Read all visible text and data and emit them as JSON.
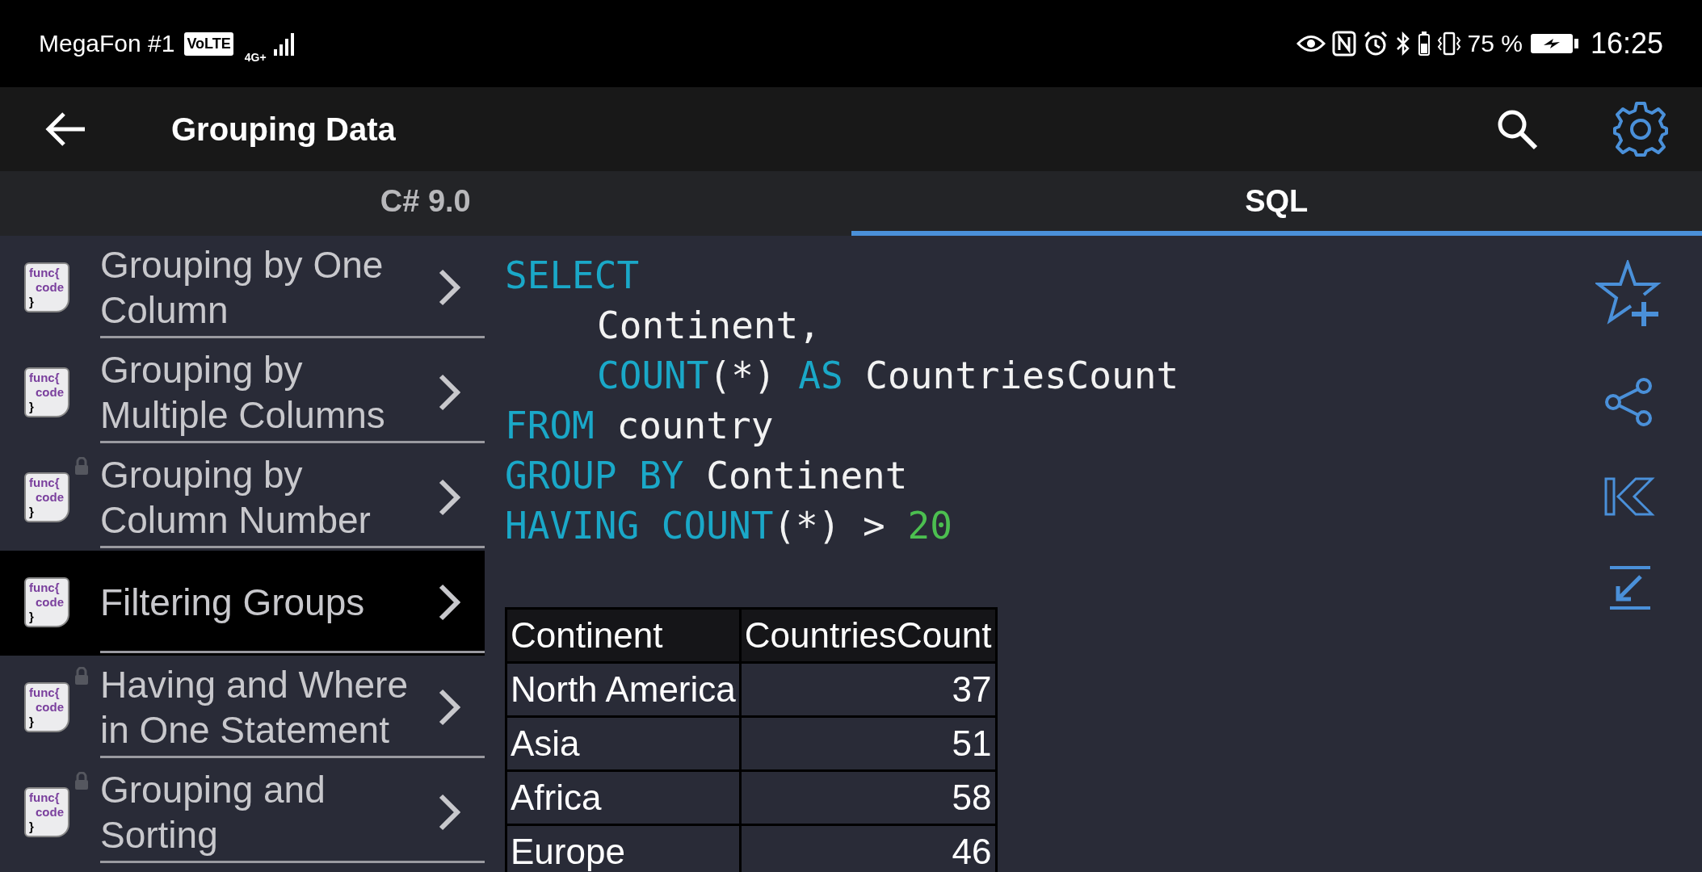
{
  "status_bar": {
    "carrier": "MegaFon #1",
    "volte": "VoLTE",
    "network": "4G+",
    "battery": "75 %",
    "time": "16:25"
  },
  "app_bar": {
    "title": "Grouping Data"
  },
  "tabs": [
    {
      "label": "C# 9.0",
      "selected": false
    },
    {
      "label": "SQL",
      "selected": true
    }
  ],
  "lessons": [
    {
      "title": "Grouping by One Column",
      "icon_lines": [
        "func{",
        "code",
        "}"
      ],
      "locked": false,
      "selected": false
    },
    {
      "title": "Grouping by Multiple Columns",
      "icon_lines": [
        "func{",
        "code",
        "}"
      ],
      "locked": false,
      "selected": false
    },
    {
      "title": "Grouping by Column Number",
      "icon_lines": [
        "func{",
        "code",
        "}"
      ],
      "locked": true,
      "selected": false
    },
    {
      "title": "Filtering Groups",
      "icon_lines": [
        "func{",
        "code",
        "}"
      ],
      "locked": false,
      "selected": true
    },
    {
      "title": "Having and Where in One Statement",
      "icon_lines": [
        "func{",
        "code",
        "}"
      ],
      "locked": true,
      "selected": false
    },
    {
      "title": "Grouping and Sorting",
      "icon_lines": [
        "func{",
        "code",
        "}"
      ],
      "locked": true,
      "selected": false
    }
  ],
  "code_lines": [
    {
      "indent": false,
      "tokens": [
        {
          "text": "SELECT",
          "kind": "keyword"
        }
      ]
    },
    {
      "indent": true,
      "tokens": [
        {
          "text": "Continent,",
          "kind": "plain"
        }
      ]
    },
    {
      "indent": true,
      "tokens": [
        {
          "text": "COUNT",
          "kind": "keyword"
        },
        {
          "text": "(*) ",
          "kind": "plain"
        },
        {
          "text": "AS",
          "kind": "keyword"
        },
        {
          "text": " CountriesCount",
          "kind": "plain"
        }
      ]
    },
    {
      "indent": false,
      "tokens": [
        {
          "text": "FROM",
          "kind": "keyword"
        },
        {
          "text": " country",
          "kind": "plain"
        }
      ]
    },
    {
      "indent": false,
      "tokens": [
        {
          "text": "GROUP BY",
          "kind": "keyword"
        },
        {
          "text": " Continent",
          "kind": "plain"
        }
      ]
    },
    {
      "indent": false,
      "tokens": [
        {
          "text": "HAVING COUNT",
          "kind": "keyword"
        },
        {
          "text": "(*) > ",
          "kind": "plain"
        },
        {
          "text": "20",
          "kind": "number"
        }
      ]
    }
  ],
  "result_table": {
    "columns": [
      "Continent",
      "CountriesCount"
    ],
    "rows": [
      [
        "North America",
        "37"
      ],
      [
        "Asia",
        "51"
      ],
      [
        "Africa",
        "58"
      ],
      [
        "Europe",
        "46"
      ]
    ]
  }
}
